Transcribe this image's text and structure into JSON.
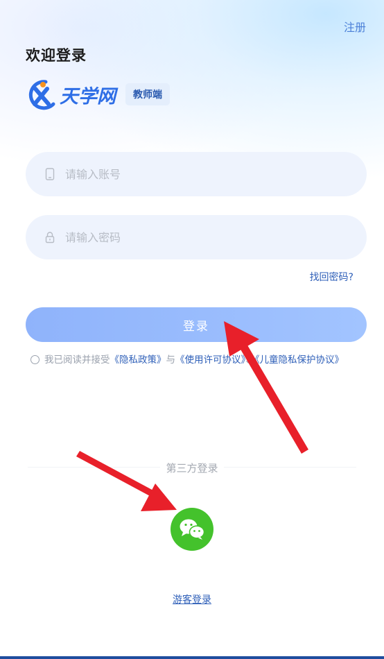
{
  "header": {
    "register_label": "注册",
    "welcome_title": "欢迎登录"
  },
  "brand": {
    "logo_icon": "tianxue-logo-icon",
    "name": "天学网",
    "role_badge": "教师端",
    "brand_color": "#2e6ee6"
  },
  "form": {
    "account": {
      "placeholder": "请输入账号",
      "value": "",
      "icon": "phone-icon"
    },
    "password": {
      "placeholder": "请输入密码",
      "value": "",
      "icon": "lock-icon"
    },
    "forgot_label": "找回密码?",
    "login_label": "登录"
  },
  "agreement": {
    "checked": false,
    "prefix": "我已阅读并接受",
    "privacy_policy": "《隐私政策》",
    "and": "与",
    "license": "《使用许可协议》",
    "separator": "、",
    "child_privacy": "《儿童隐私保护协议》"
  },
  "third_party": {
    "title": "第三方登录",
    "wechat_icon": "wechat-icon",
    "wechat_color": "#44c22c"
  },
  "guest_label": "游客登录",
  "colors": {
    "link": "#2e5fb8",
    "button_gradient_start": "#8fb3fb",
    "button_gradient_end": "#a2c4ff",
    "annotation_arrow": "#e8202a"
  }
}
